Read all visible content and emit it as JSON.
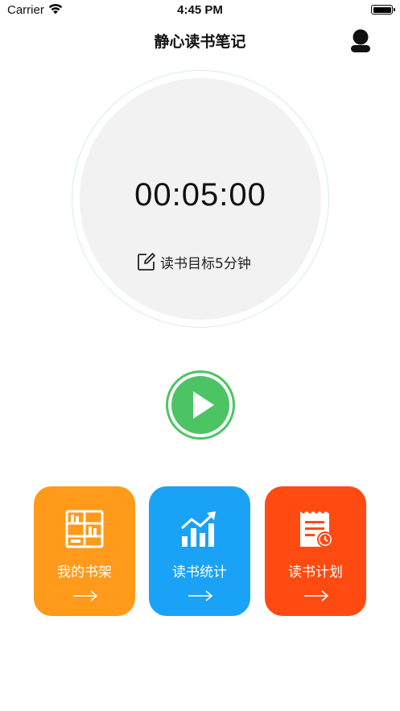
{
  "status_bar": {
    "carrier": "Carrier",
    "time": "4:45 PM"
  },
  "header": {
    "title": "静心读书笔记",
    "profile_icon": "person-icon"
  },
  "timer": {
    "time": "00:05:00",
    "goal_text": "读书目标5分钟",
    "goal_icon": "edit-icon"
  },
  "play": {
    "icon": "play-icon",
    "color": "#4dc464"
  },
  "cards": [
    {
      "label": "我的书架",
      "icon": "bookshelf-icon",
      "color": "#ff9a1a"
    },
    {
      "label": "读书统计",
      "icon": "chart-icon",
      "color": "#1aa2f7"
    },
    {
      "label": "读书计划",
      "icon": "plan-icon",
      "color": "#ff4b12"
    }
  ]
}
